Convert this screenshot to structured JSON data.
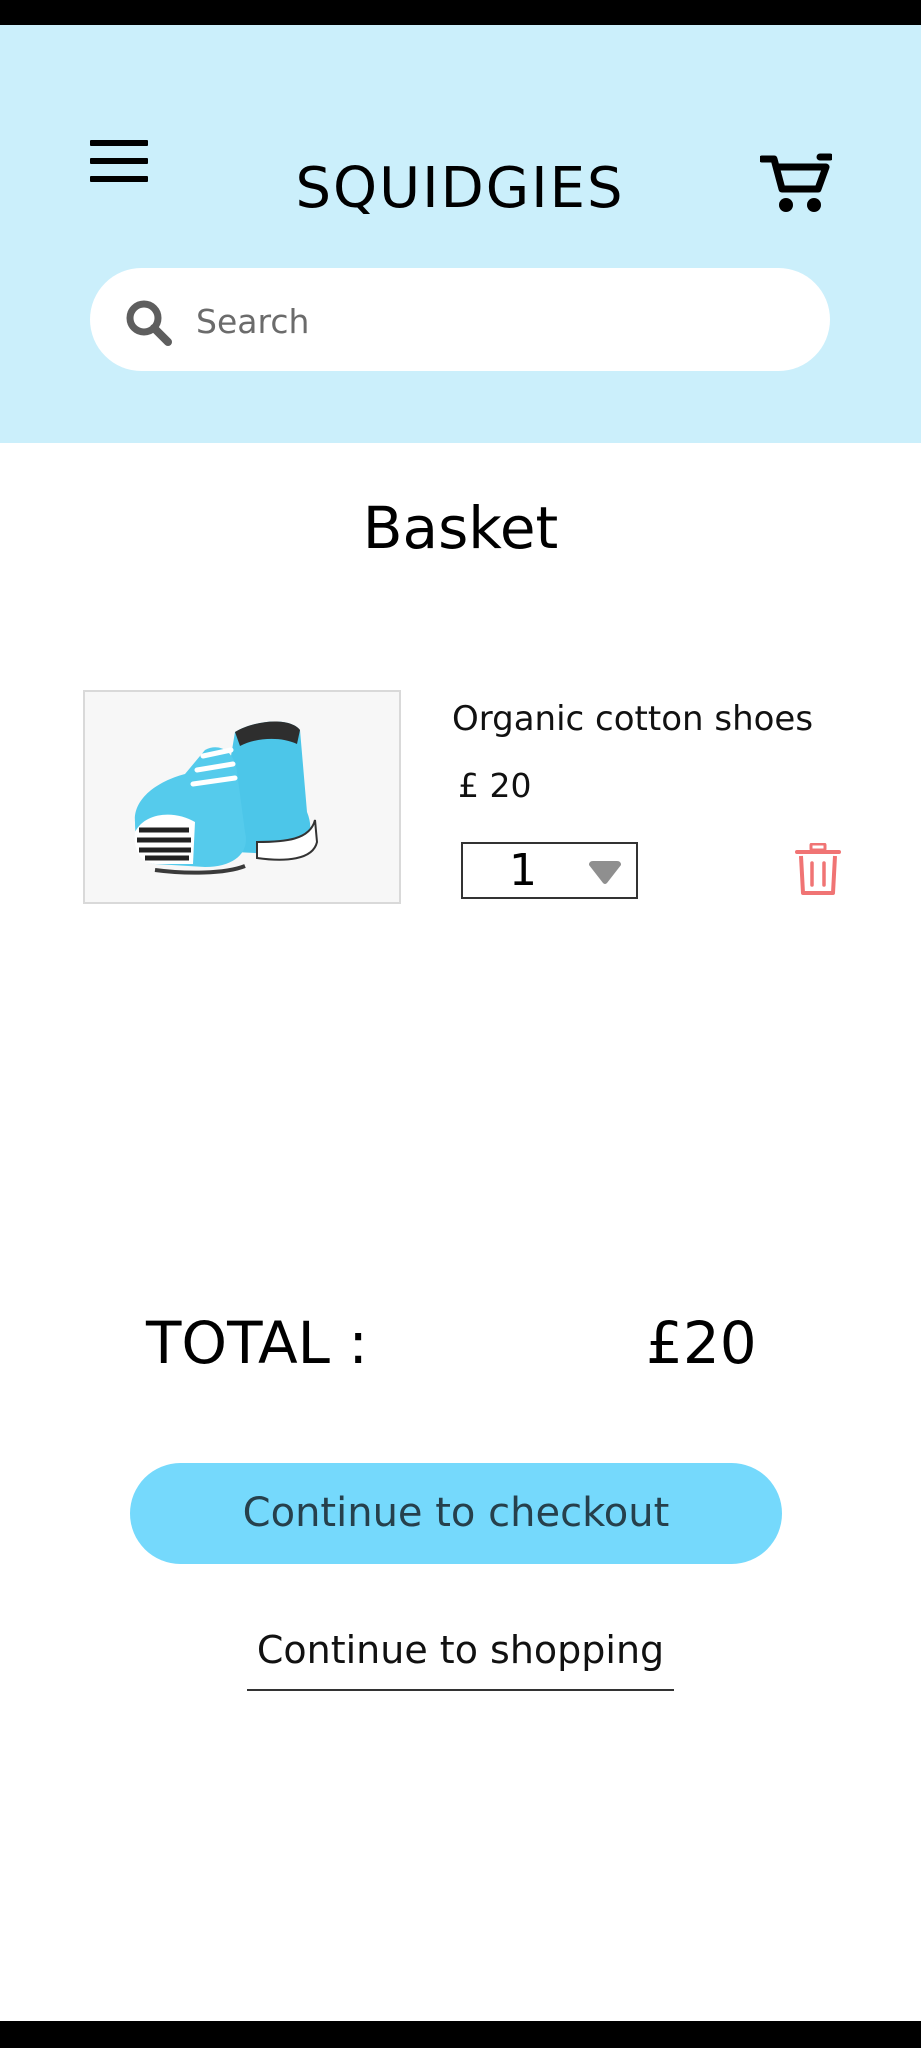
{
  "header": {
    "logo_text": "SQUIDGIES",
    "search": {
      "placeholder": "Search",
      "value": ""
    },
    "background_color": "#cbeffb",
    "icons": [
      "hamburger-menu-icon",
      "shopping-cart-icon",
      "search-icon"
    ]
  },
  "page": {
    "title": "Basket"
  },
  "basket": {
    "items": [
      {
        "name": "Organic cotton shoes",
        "price": "£ 20",
        "quantity": "1",
        "image": "blue baby shoes with striped toe caps",
        "icons": [
          "chevron-down-icon",
          "trash-icon"
        ]
      }
    ]
  },
  "summary": {
    "total_label": "TOTAL :",
    "total_value": "£20"
  },
  "actions": {
    "checkout_label": "Continue to checkout",
    "continue_shopping_label": "Continue to shopping"
  },
  "colors": {
    "accent": "#75d9fc",
    "delete_icon": "#f07474",
    "header_bg": "#cbeffb"
  }
}
